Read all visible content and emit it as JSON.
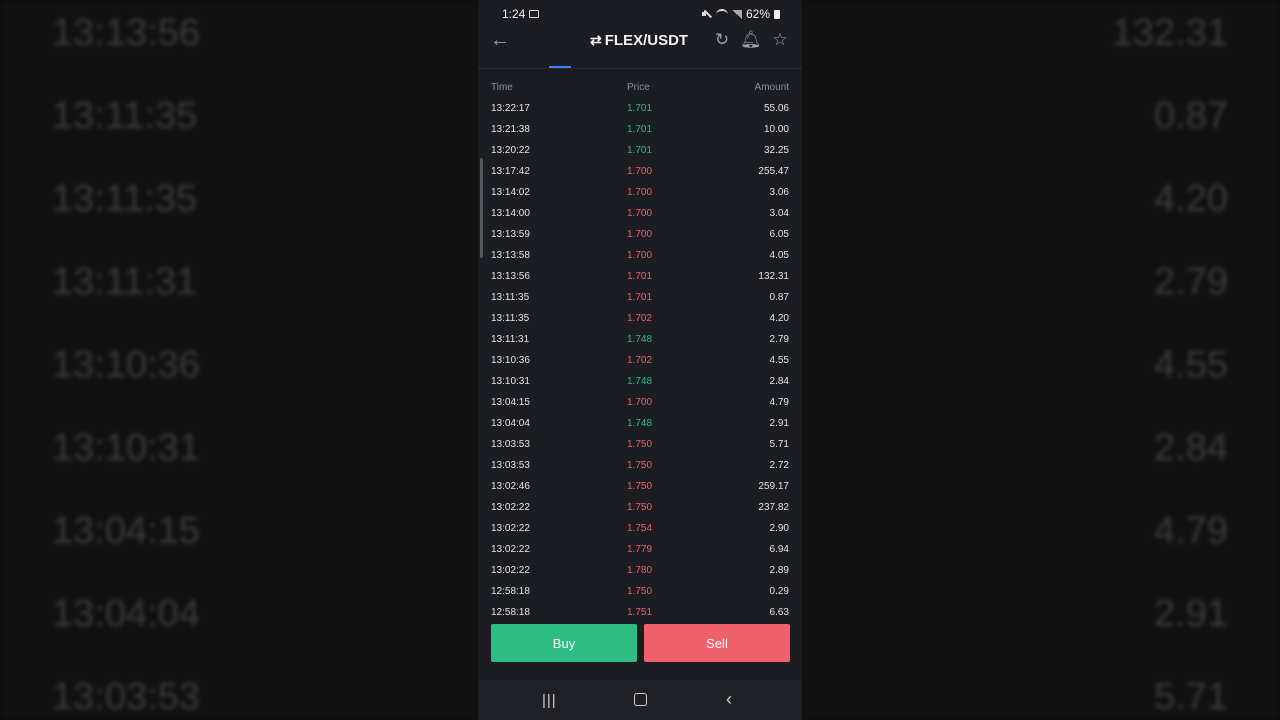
{
  "background": {
    "left_items": [
      "13:13:56",
      "13:11:35",
      "13:11:35",
      "13:11:31",
      "13:10:36",
      "13:10:31",
      "13:04:15",
      "13:04:04",
      "13:03:53"
    ],
    "right_items": [
      "132.31",
      "0.87",
      "4.20",
      "2.79",
      "4.55",
      "2.84",
      "4.79",
      "2.91",
      "5.71"
    ]
  },
  "status_bar": {
    "time": "1:24",
    "battery": "62%"
  },
  "header": {
    "back_icon": "arrow-left-icon",
    "swap_icon": "⇄",
    "pair": "FLEX/USDT"
  },
  "trades": {
    "columns": {
      "time": "Time",
      "price": "Price",
      "amount": "Amount"
    },
    "rows": [
      {
        "time": "13:22:17",
        "price": "1.701",
        "amount": "55.06",
        "side": "up"
      },
      {
        "time": "13:21:38",
        "price": "1.701",
        "amount": "10.00",
        "side": "up"
      },
      {
        "time": "13:20:22",
        "price": "1.701",
        "amount": "32.25",
        "side": "up"
      },
      {
        "time": "13:17:42",
        "price": "1.700",
        "amount": "255.47",
        "side": "down"
      },
      {
        "time": "13:14:02",
        "price": "1.700",
        "amount": "3.06",
        "side": "down"
      },
      {
        "time": "13:14:00",
        "price": "1.700",
        "amount": "3.04",
        "side": "down"
      },
      {
        "time": "13:13:59",
        "price": "1.700",
        "amount": "6.05",
        "side": "down"
      },
      {
        "time": "13:13:58",
        "price": "1.700",
        "amount": "4.05",
        "side": "down"
      },
      {
        "time": "13:13:56",
        "price": "1.701",
        "amount": "132.31",
        "side": "down"
      },
      {
        "time": "13:11:35",
        "price": "1.701",
        "amount": "0.87",
        "side": "down"
      },
      {
        "time": "13:11:35",
        "price": "1.702",
        "amount": "4.20",
        "side": "down"
      },
      {
        "time": "13:11:31",
        "price": "1.748",
        "amount": "2.79",
        "side": "up"
      },
      {
        "time": "13:10:36",
        "price": "1.702",
        "amount": "4.55",
        "side": "down"
      },
      {
        "time": "13:10:31",
        "price": "1.748",
        "amount": "2.84",
        "side": "up"
      },
      {
        "time": "13:04:15",
        "price": "1.700",
        "amount": "4.79",
        "side": "down"
      },
      {
        "time": "13:04:04",
        "price": "1.748",
        "amount": "2.91",
        "side": "up"
      },
      {
        "time": "13:03:53",
        "price": "1.750",
        "amount": "5.71",
        "side": "down"
      },
      {
        "time": "13:03:53",
        "price": "1.750",
        "amount": "2.72",
        "side": "down"
      },
      {
        "time": "13:02:46",
        "price": "1.750",
        "amount": "259.17",
        "side": "down"
      },
      {
        "time": "13:02:22",
        "price": "1.750",
        "amount": "237.82",
        "side": "down"
      },
      {
        "time": "13:02:22",
        "price": "1.754",
        "amount": "2.90",
        "side": "down"
      },
      {
        "time": "13:02:22",
        "price": "1.779",
        "amount": "6.94",
        "side": "down"
      },
      {
        "time": "13:02:22",
        "price": "1.780",
        "amount": "2.89",
        "side": "down"
      },
      {
        "time": "12:58:18",
        "price": "1.750",
        "amount": "0.29",
        "side": "down"
      },
      {
        "time": "12:58:18",
        "price": "1.751",
        "amount": "6.63",
        "side": "down"
      }
    ]
  },
  "actions": {
    "buy_label": "Buy",
    "sell_label": "Sell"
  },
  "colors": {
    "up": "#2ebd85",
    "down": "#f0616d",
    "accent": "#3b82f6"
  }
}
